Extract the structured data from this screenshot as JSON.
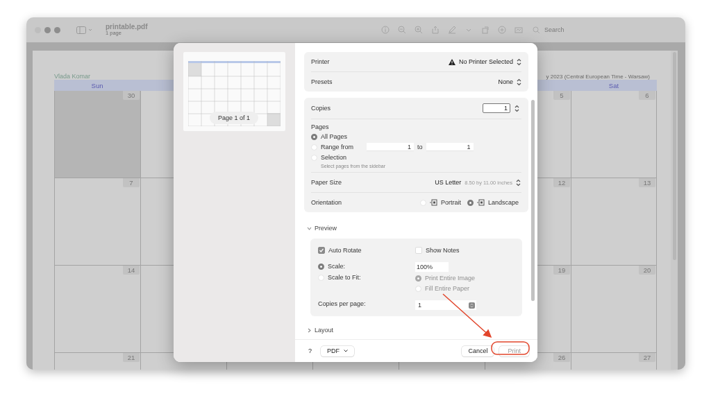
{
  "window": {
    "title": "printable.pdf",
    "subtitle": "1 page",
    "search": {
      "placeholder": "Search"
    }
  },
  "document": {
    "author": "Vlada Komar",
    "title": "y 2023 (Central European Time - Warsaw)",
    "headers": {
      "sun": "Sun",
      "sat": "Sat"
    },
    "weeks": [
      {
        "sun": {
          "day": "30",
          "outside_month": true
        },
        "fri": {
          "day": "5",
          "outside_month": false
        },
        "sat": {
          "day": "6",
          "outside_month": false
        }
      },
      {
        "sun": {
          "day": "7",
          "outside_month": false
        },
        "fri": {
          "day": "12",
          "outside_month": false
        },
        "sat": {
          "day": "13",
          "outside_month": false
        }
      },
      {
        "sun": {
          "day": "14",
          "outside_month": false
        },
        "fri": {
          "day": "19",
          "outside_month": false
        },
        "sat": {
          "day": "20",
          "outside_month": false
        }
      },
      {
        "sun": {
          "day": "21",
          "outside_month": false
        },
        "fri": {
          "day": "26",
          "outside_month": false
        },
        "sat": {
          "day": "27",
          "outside_month": false
        }
      }
    ]
  },
  "print_dialog": {
    "thumbnail": {
      "page_label": "Page 1 of 1"
    },
    "printer": {
      "label": "Printer",
      "value": "No Printer Selected",
      "warning": true
    },
    "presets": {
      "label": "Presets",
      "value": "None"
    },
    "copies": {
      "label": "Copies",
      "value": "1"
    },
    "pages": {
      "label": "Pages",
      "options": [
        {
          "kind": "plain",
          "label": "All Pages",
          "selected": true
        },
        {
          "kind": "range",
          "label": "Range from",
          "selected": false,
          "from": "1",
          "to_label": "to",
          "to": "1"
        },
        {
          "kind": "hint",
          "label": "Selection",
          "selected": false,
          "hint": "Select pages from the sidebar"
        }
      ]
    },
    "paper_size": {
      "label": "Paper Size",
      "value": "US Letter",
      "detail": "8.50 by 11.00 inches"
    },
    "orientation": {
      "label": "Orientation",
      "options": [
        {
          "label": "Portrait",
          "selected": false
        },
        {
          "label": "Landscape",
          "selected": true
        }
      ]
    },
    "preview": {
      "title": "Preview",
      "expanded": true,
      "auto_rotate": {
        "label": "Auto Rotate",
        "checked": true
      },
      "show_notes": {
        "label": "Show Notes",
        "checked": false
      },
      "scale_options": [
        {
          "label": "Scale:",
          "selected": true
        },
        {
          "label": "Scale to Fit:",
          "selected": false
        }
      ],
      "scale_value": "100%",
      "fit_options": [
        {
          "label": "Print Entire Image",
          "selected": true,
          "disabled": true
        },
        {
          "label": "Fill Entire Paper",
          "selected": false,
          "disabled": true
        }
      ],
      "copies_per_page": {
        "label": "Copies per page:",
        "value": "1"
      }
    },
    "layout": {
      "title": "Layout",
      "expanded": false
    },
    "footer": {
      "help": "?",
      "pdf": "PDF",
      "cancel": "Cancel",
      "print": "Print",
      "print_disabled": true
    }
  }
}
